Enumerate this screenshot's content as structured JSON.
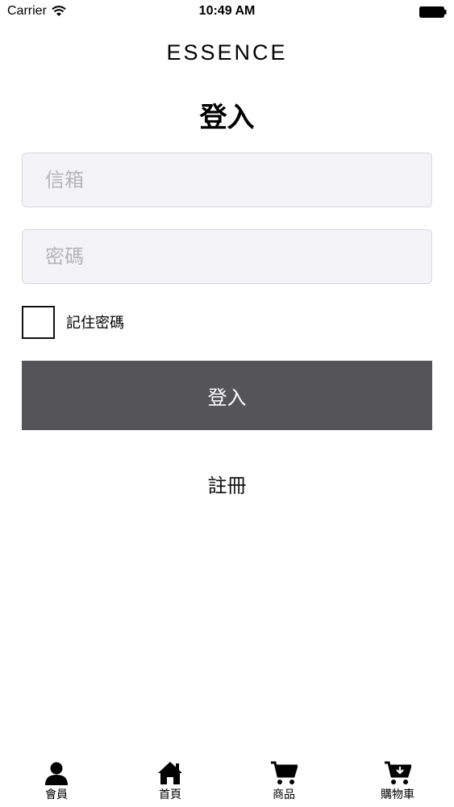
{
  "status_bar": {
    "carrier": "Carrier",
    "time": "10:49 AM",
    "icons": [
      "wifi-icon",
      "battery-icon"
    ]
  },
  "header": {
    "brand": "ESSENCE",
    "title": "登入"
  },
  "form": {
    "email_placeholder": "信箱",
    "password_placeholder": "密碼",
    "remember_label": "記住密碼",
    "login_label": "登入",
    "register_label": "註冊"
  },
  "tab_bar": {
    "items": [
      {
        "label": "會員",
        "icon": "person-icon"
      },
      {
        "label": "首頁",
        "icon": "home-icon"
      },
      {
        "label": "商品",
        "icon": "cart-icon"
      },
      {
        "label": "購物車",
        "icon": "cart-download-icon"
      }
    ]
  },
  "colors": {
    "login_button_bg": "#555457",
    "field_bg": "#f4f3f6",
    "placeholder": "#b5b4b8"
  }
}
